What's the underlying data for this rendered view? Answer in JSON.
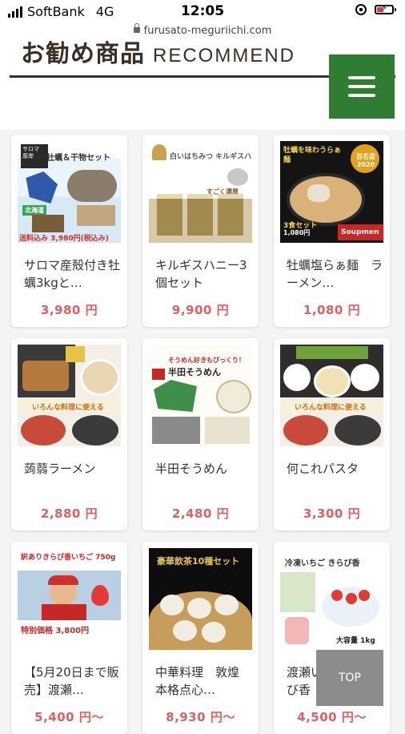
{
  "status": {
    "carrier": "SoftBank",
    "network": "4G",
    "time": "12:05"
  },
  "browser": {
    "url": "furusato-meguriichi.com"
  },
  "header": {
    "title_ja": "お勧め商品",
    "title_en": "RECOMMEND"
  },
  "products": [
    {
      "name": "サロマ産殻付き牡蠣3kgと…",
      "price": "3,980 円",
      "thumb_texts": [
        "牡蠣＆干物セット",
        "北海道",
        "送料込み 3,980円(税込み)"
      ]
    },
    {
      "name": "キルギスハニー3個セット",
      "price": "9,900 円",
      "thumb_texts": [
        "白いはちみつ キルギスハニー",
        "すごく濃厚"
      ]
    },
    {
      "name": "牡蠣塩らぁ麺　ラーメン…",
      "price": "1,080 円",
      "thumb_texts": [
        "牡蠣を味わうらぁ麺",
        "百名店 2020",
        "3食セット",
        "1,080円",
        "Soupmen"
      ]
    },
    {
      "name": "蒟蒻ラーメン",
      "price": "2,880 円",
      "thumb_texts": [
        "いろんな料理に使える"
      ]
    },
    {
      "name": "半田そうめん",
      "price": "2,480 円",
      "thumb_texts": [
        "そうめん好きもびっくり！",
        "半田そうめん"
      ]
    },
    {
      "name": "何これパスタ",
      "price": "3,300 円",
      "thumb_texts": [
        "いろんな料理に使える"
      ]
    },
    {
      "name": "【5月20日まで販売】渡瀬…",
      "price": "5,400 円～",
      "thumb_texts": [
        "訳ありきらび香いちご 750g",
        "特別価格 3,800円"
      ]
    },
    {
      "name": "中華料理　敦煌　本格点心…",
      "price": "8,930 円～",
      "thumb_texts": [
        "豪華飲茶10種セット"
      ]
    },
    {
      "name": "渡瀬いちご きらび香（冷…",
      "price": "4,500 円～",
      "thumb_texts": [
        "冷凍いちご きらび香",
        "大容量 1kg"
      ]
    }
  ],
  "top_button": "TOP",
  "colors": {
    "accent_green": "#2e7d32",
    "price_red": "#e06060",
    "heading_brown": "#3a2f28"
  }
}
